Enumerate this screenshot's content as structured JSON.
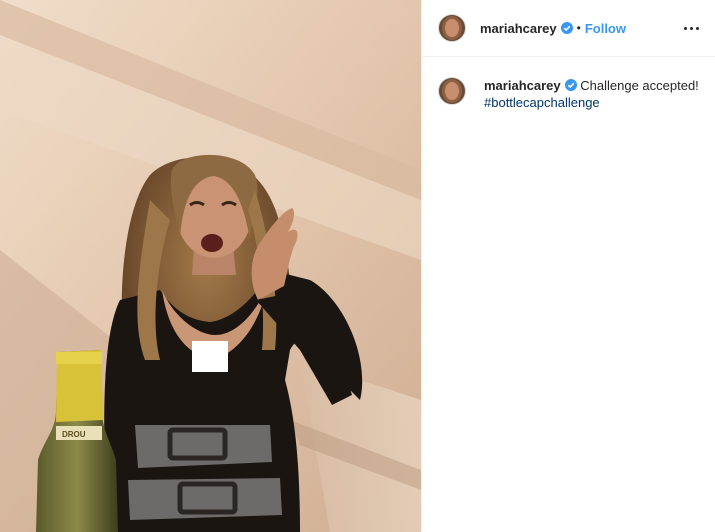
{
  "post": {
    "author": "mariahcarey",
    "verified": true,
    "separator": "•",
    "follow_label": "Follow",
    "more_icon": "more-options-icon",
    "caption_text": "Challenge accepted!",
    "hashtag": "#bottlecapchallenge"
  },
  "colors": {
    "accent": "#3897f0",
    "hashtag": "#003569",
    "text": "#262626"
  }
}
